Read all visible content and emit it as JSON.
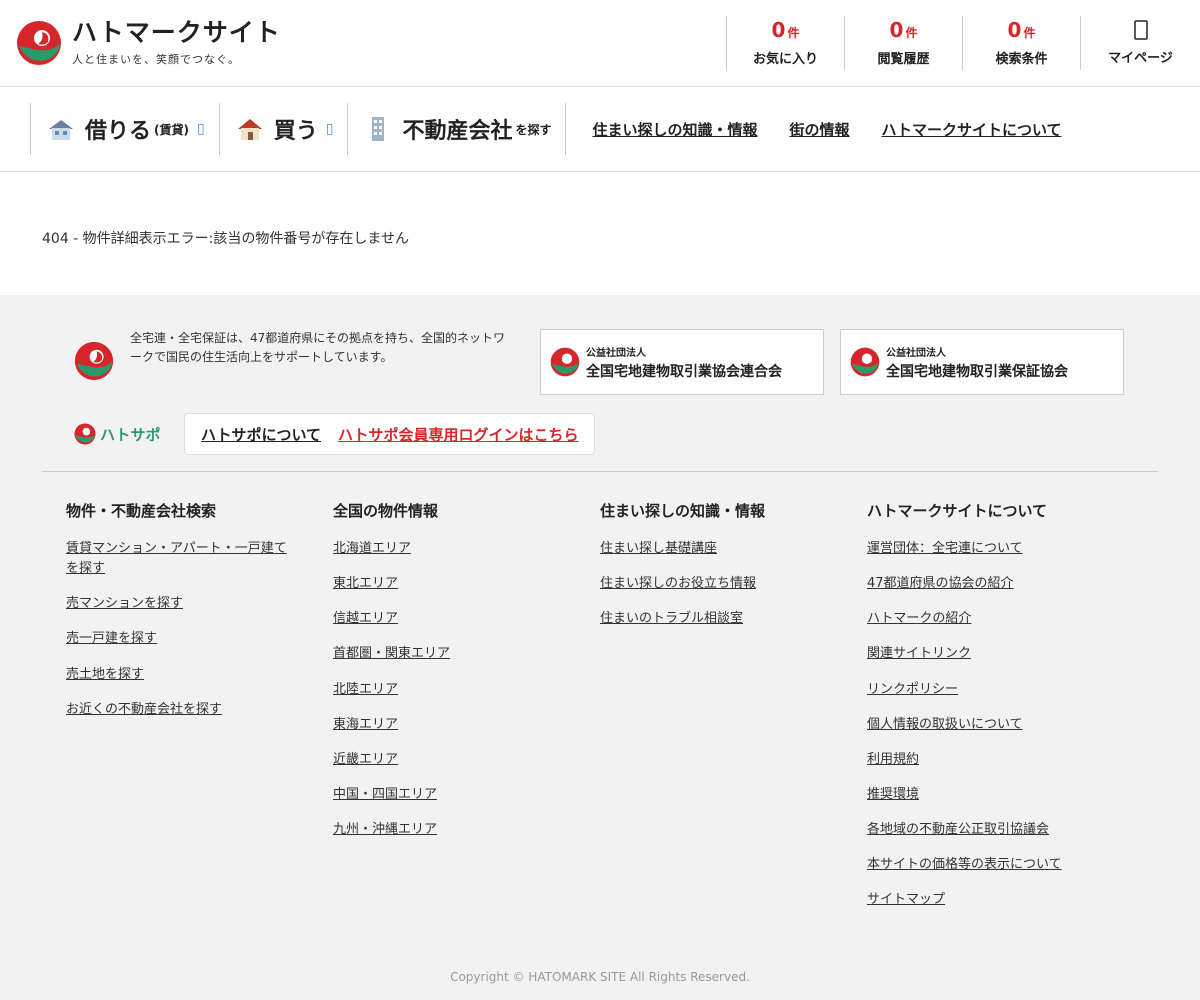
{
  "header": {
    "logo_title": "ハトマークサイト",
    "logo_sub": "人と住まいを、笑顔でつなぐ。",
    "stats": [
      {
        "count": "0",
        "unit": "件",
        "label": "お気に入り"
      },
      {
        "count": "0",
        "unit": "件",
        "label": "閲覧履歴"
      },
      {
        "count": "0",
        "unit": "件",
        "label": "検索条件"
      }
    ],
    "mypage_label": "マイページ"
  },
  "nav": {
    "rent_main": "借りる",
    "rent_sub": "(賃貸)",
    "buy_main": "買う",
    "company_main": "不動産会社",
    "company_sub": "を探す",
    "links": [
      "住まい探しの知識・情報",
      "街の情報",
      "ハトマークサイトについて"
    ]
  },
  "main": {
    "error_message": "404 - 物件詳細表示エラー:該当の物件番号が存在しません"
  },
  "footer": {
    "org_text": "全宅連・全宅保証は、47都道府県にその拠点を持ち、全国的ネットワークで国民の住生活向上をサポートしています。",
    "org_boxes": [
      {
        "small": "公益社団法人",
        "big": "全国宅地建物取引業協会連合会"
      },
      {
        "small": "公益社団法人",
        "big": "全国宅地建物取引業保証協会"
      }
    ],
    "hatosapo_logo": "ハトサポ",
    "hatosapo_about": "ハトサポについて",
    "hatosapo_login": "ハトサポ会員専用ログインはこちら",
    "columns": [
      {
        "title": "物件・不動産会社検索",
        "links": [
          "賃貸マンション・アパート・一戸建てを探す",
          "売マンションを探す",
          "売一戸建を探す",
          "売土地を探す",
          "お近くの不動産会社を探す"
        ]
      },
      {
        "title": "全国の物件情報",
        "links": [
          "北海道エリア",
          "東北エリア",
          "信越エリア",
          "首都圏・関東エリア",
          "北陸エリア",
          "東海エリア",
          "近畿エリア",
          "中国・四国エリア",
          "九州・沖縄エリア"
        ]
      },
      {
        "title": "住まい探しの知識・情報",
        "links": [
          "住まい探し基礎講座",
          "住まい探しのお役立ち情報",
          "住まいのトラブル相談室"
        ]
      },
      {
        "title": "ハトマークサイトについて",
        "links": [
          "運営団体：全宅連について",
          "47都道府県の協会の紹介",
          "ハトマークの紹介",
          "関連サイトリンク",
          "リンクポリシー",
          "個人情報の取扱いについて",
          "利用規約",
          "推奨環境",
          "各地域の不動産公正取引協議会",
          "本サイトの価格等の表示について",
          "サイトマップ"
        ]
      }
    ],
    "copyright": "Copyright © HATOMARK SITE All Rights Reserved."
  },
  "colors": {
    "accent_red": "#d6262b",
    "brand_green": "#2a9a6a",
    "footer_bg": "#f2f2f2"
  },
  "icons": [
    "hatomark-logo-icon",
    "rent-house-icon",
    "buy-house-icon",
    "building-icon",
    "user-icon",
    "chevron-down-icon"
  ]
}
